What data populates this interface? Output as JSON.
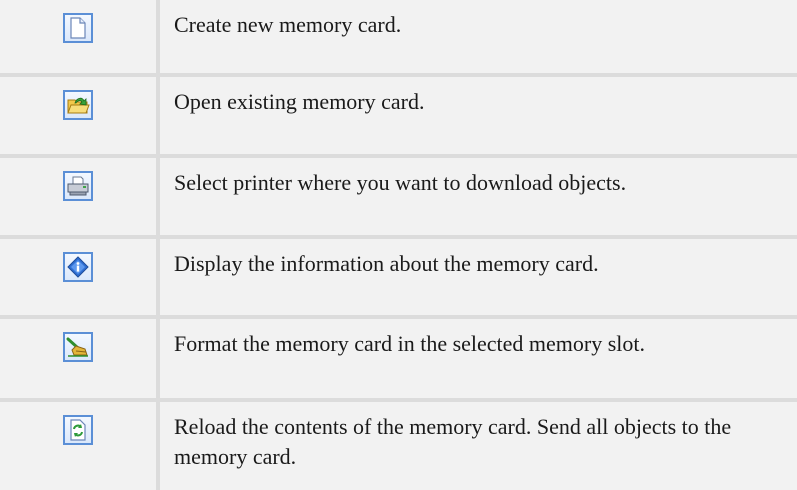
{
  "rows": [
    {
      "icon": "new-document-icon",
      "text": "Create new memory card."
    },
    {
      "icon": "open-folder-icon",
      "text": "Open existing memory card."
    },
    {
      "icon": "printer-icon",
      "text": "Select printer where you want to download objects."
    },
    {
      "icon": "info-icon",
      "text": "Display the information about the memory card."
    },
    {
      "icon": "format-broom-icon",
      "text": "Format the memory card in the selected memory slot."
    },
    {
      "icon": "reload-icon",
      "text": "Reload the contents of the memory card. Send all objects to the memory card."
    }
  ],
  "colors": {
    "cell_background": "#f2f2f2",
    "divider": "#dcdcdc",
    "icon_border": "#5b8fd6"
  }
}
